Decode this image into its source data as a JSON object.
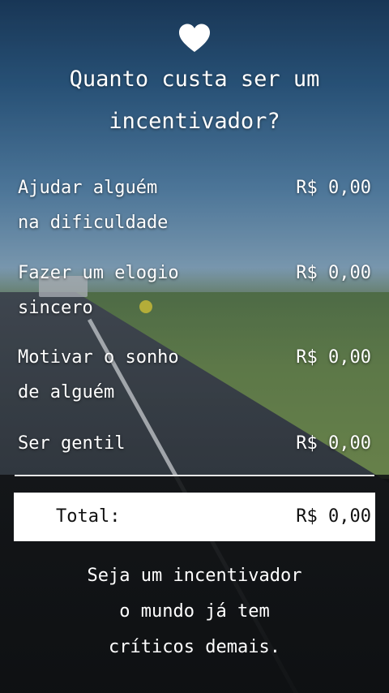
{
  "title": {
    "line1": "Quanto custa ser um",
    "line2": "incentivador?"
  },
  "items": [
    {
      "label_line1": "Ajudar alguém",
      "label_line2": "na dificuldade",
      "price": "R$ 0,00"
    },
    {
      "label_line1": "Fazer um elogio",
      "label_line2": "sincero",
      "price": "R$ 0,00"
    },
    {
      "label_line1": "Motivar o sonho",
      "label_line2": "de alguém",
      "price": "R$ 0,00"
    },
    {
      "label_line1": "Ser gentil",
      "label_line2": "",
      "price": "R$ 0,00"
    }
  ],
  "total": {
    "label": "Total:",
    "value": "R$ 0,00"
  },
  "footer": {
    "line1": "Seja um incentivador",
    "line2": "o mundo já tem",
    "line3": "críticos demais."
  },
  "icons": {
    "top": "heart-icon"
  },
  "colors": {
    "text": "#ffffff",
    "total_box": "#ffffff",
    "total_text": "#111111"
  }
}
